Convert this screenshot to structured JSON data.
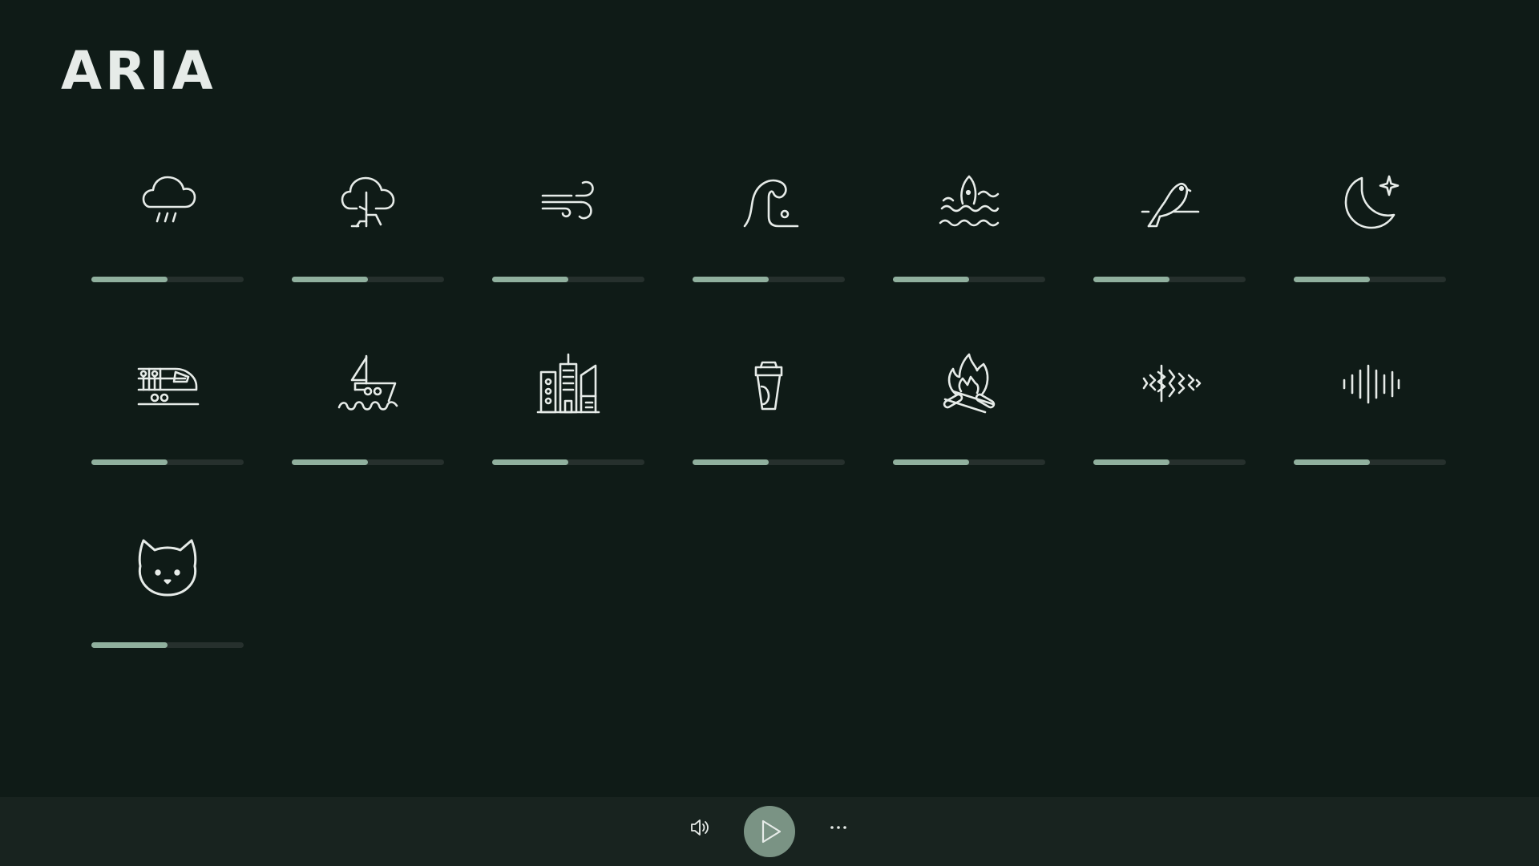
{
  "app": {
    "title": "ARIA",
    "accent_color": "#90b09e",
    "background_color": "#0f1b17"
  },
  "sounds": [
    {
      "icon": "rain-icon",
      "volume": 0.5
    },
    {
      "icon": "thunderstorm-icon",
      "volume": 0.5
    },
    {
      "icon": "wind-icon",
      "volume": 0.5
    },
    {
      "icon": "wave-icon",
      "volume": 0.5
    },
    {
      "icon": "sea-waves-icon",
      "volume": 0.5
    },
    {
      "icon": "bird-icon",
      "volume": 0.5
    },
    {
      "icon": "night-moon-icon",
      "volume": 0.5
    },
    {
      "icon": "train-icon",
      "volume": 0.5
    },
    {
      "icon": "boat-icon",
      "volume": 0.5
    },
    {
      "icon": "city-icon",
      "volume": 0.5
    },
    {
      "icon": "coffee-cup-icon",
      "volume": 0.5
    },
    {
      "icon": "campfire-icon",
      "volume": 0.5
    },
    {
      "icon": "white-noise-icon",
      "volume": 0.5
    },
    {
      "icon": "pink-noise-icon",
      "volume": 0.5
    },
    {
      "icon": "cat-purr-icon",
      "volume": 0.5
    }
  ],
  "player": {
    "volume_icon": "volume-icon",
    "play_icon": "play-icon",
    "more_icon": "more-dots-icon"
  }
}
